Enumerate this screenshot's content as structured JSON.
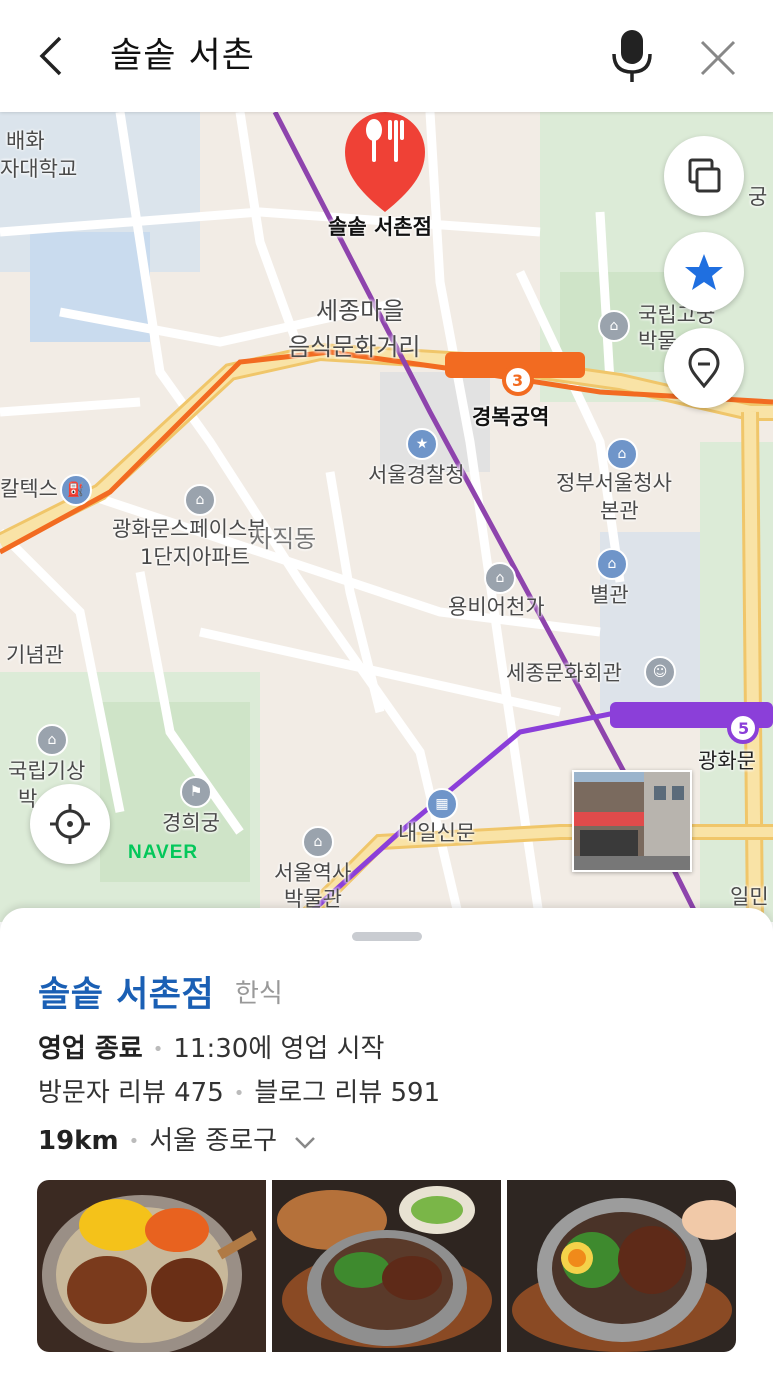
{
  "header": {
    "search_query": "솔솥 서촌",
    "back_icon": "chevron-left-icon",
    "mic_icon": "microphone-icon",
    "close_icon": "close-icon"
  },
  "map": {
    "labels": {
      "place_marker": "솔솥 서촌점",
      "paejae": "배화",
      "women_univ": "자대학교",
      "sejong_village": "세종마을",
      "food_street": "음식문화거리",
      "gyeongbokgung_station": "경복궁역",
      "station_line": "3",
      "police": "서울경찰청",
      "gov_complex": "정부서울청사",
      "gov_complex_main": "본관",
      "annex": "별관",
      "kwanghwamun_space": "광화문스페이스본",
      "apt": "1단지아파트",
      "district": "사직동",
      "yongbi": "용비어천가",
      "sejong_center": "세종문화회관",
      "gwanghwamun_station": "광화문",
      "gwanghwamun_line": "5",
      "memorial": "기념관",
      "meteorology": "국립기상",
      "meteorology_2": "박",
      "gyeonghuigung": "경희궁",
      "naeil": "내일신문",
      "seoul_museum": "서울역사",
      "seoul_museum_2": "박물관",
      "national_museum": "국립고궁",
      "national_museum_2": "박물",
      "gung": "궁",
      "caltex": "칼텍스",
      "ilmin": "일민"
    },
    "naver_logo": "NAVER",
    "controls": {
      "layers_icon": "layers-icon",
      "favorite_icon": "star-icon",
      "location_pin_icon": "location-pin-icon",
      "my_location_icon": "crosshair-icon"
    },
    "colors": {
      "line3": "#f26b21",
      "line5": "#8b3fd9",
      "subway_other": "#7a2f9e",
      "road": "#f4d48a",
      "marker": "#ef4136",
      "star": "#1f6fe0"
    }
  },
  "place": {
    "name": "솔솥 서촌점",
    "category": "한식",
    "status": "영업 종료",
    "open_info": "11:30에 영업 시작",
    "visitor_reviews": "방문자 리뷰 475",
    "blog_reviews": "블로그 리뷰 591",
    "distance": "19km",
    "address": "서울 종로구",
    "chevron_icon": "chevron-down-icon",
    "photos": [
      "dish-photo-1",
      "dish-photo-2",
      "dish-photo-3"
    ]
  }
}
